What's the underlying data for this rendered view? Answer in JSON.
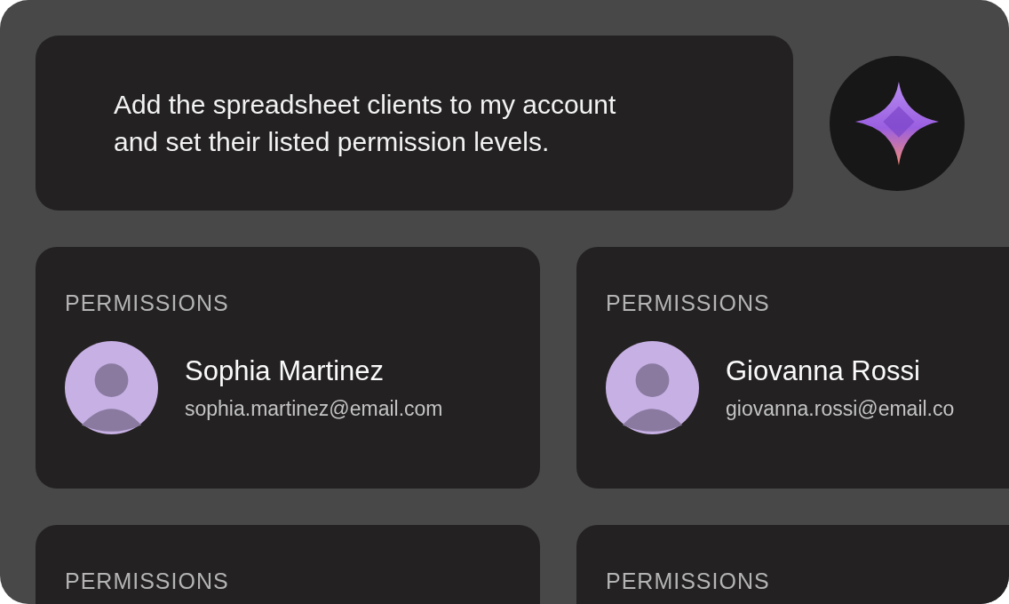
{
  "prompt": {
    "lines": [
      "Add the spreadsheet clients to my account",
      "and set their listed permission levels."
    ]
  },
  "cards": [
    {
      "label": "PERMISSIONS",
      "name": "Sophia Martinez",
      "email": "sophia.martinez@email.com"
    },
    {
      "label": "PERMISSIONS",
      "name": "Giovanna Rossi",
      "email": "giovanna.rossi@email.co"
    },
    {
      "label": "PERMISSIONS"
    },
    {
      "label": "PERMISSIONS"
    }
  ]
}
